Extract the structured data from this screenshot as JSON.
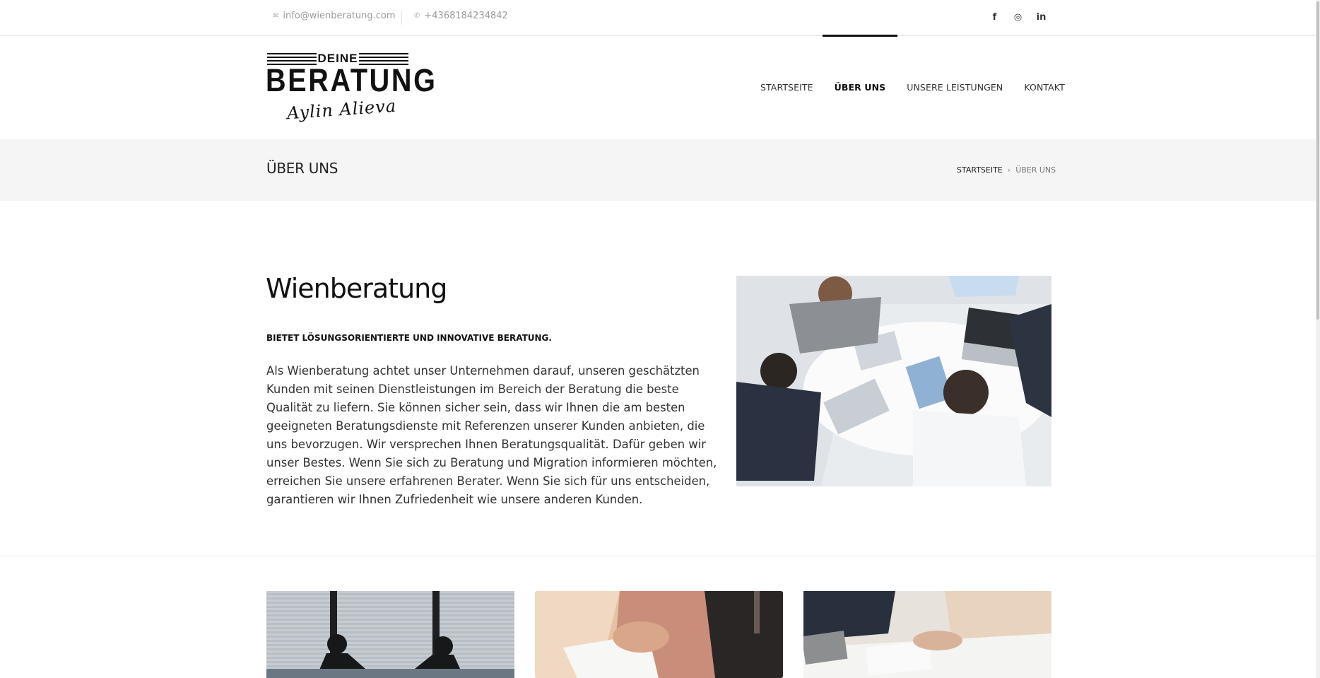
{
  "topbar": {
    "email": "info@wienberatung.com",
    "phone": "+4368184234842",
    "email_icon": "envelope-icon",
    "phone_icon": "phone-icon",
    "social": [
      {
        "icon": "facebook-icon",
        "glyph": "f"
      },
      {
        "icon": "instagram-icon",
        "glyph": "◎"
      },
      {
        "icon": "linkedin-icon",
        "glyph": "in"
      }
    ]
  },
  "logo": {
    "top": "DEINE",
    "main": "BERATUNG",
    "signature": "Aylin Alieva"
  },
  "nav": {
    "items": [
      {
        "label": "STARTSEITE",
        "active": false
      },
      {
        "label": "ÜBER UNS",
        "active": true
      },
      {
        "label": "UNSERE LEISTUNGEN",
        "active": false
      },
      {
        "label": "KONTAKT",
        "active": false
      }
    ]
  },
  "page": {
    "title": "ÜBER UNS",
    "breadcrumb": {
      "home": "STARTSEITE",
      "current": "ÜBER UNS"
    }
  },
  "main": {
    "heading": "Wienberatung",
    "subheading": "BIETET LÖSUNGSORIENTIERTE UND INNOVATIVE BERATUNG.",
    "body": "Als Wienberatung achtet unser Unternehmen darauf, unseren geschätzten Kunden mit seinen Dienstleistungen im Bereich der Beratung die beste Qualität zu liefern. Sie können sicher sein, dass wir Ihnen die am besten geeigneten Beratungsdienste mit Referenzen unserer Kunden anbieten, die uns bevorzugen. Wir versprechen Ihnen Beratungsqualität. Dafür geben wir unser Bestes. Wenn Sie sich zu Beratung und Migration informieren möchten, erreichen Sie unsere erfahrenen Berater. Wenn Sie sich für uns entscheiden, garantieren wir Ihnen Zufriedenheit wie unsere anderen Kunden."
  },
  "colors": {
    "accent": "#111111",
    "titlebar_bg": "#f5f5f5",
    "muted": "#9a9a9a"
  }
}
